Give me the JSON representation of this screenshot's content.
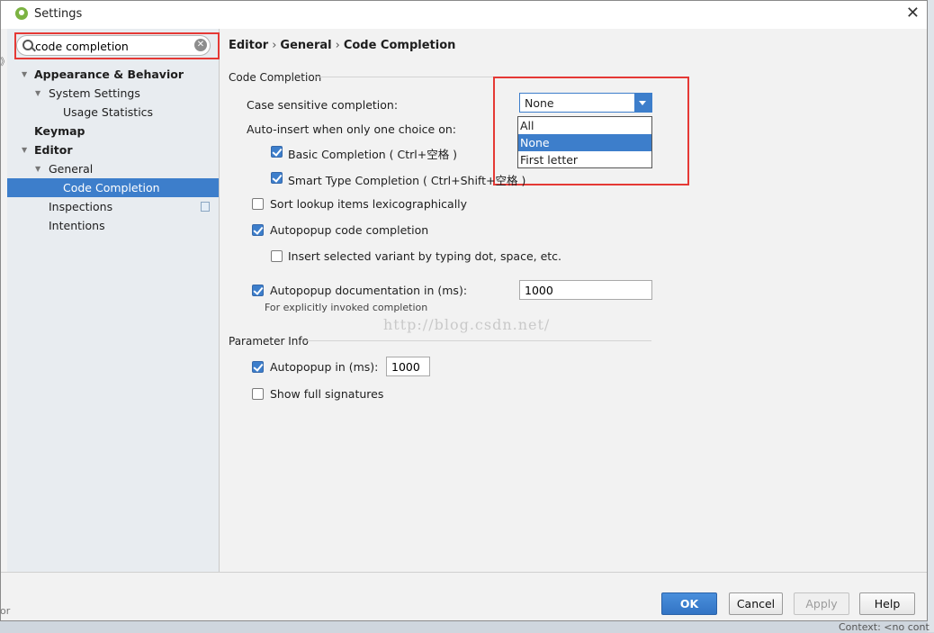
{
  "window": {
    "title": "Settings",
    "close_glyph": "✕"
  },
  "search": {
    "value": "code completion",
    "clear_glyph": "✕"
  },
  "tree": [
    {
      "label": "Appearance & Behavior"
    },
    {
      "label": "System Settings"
    },
    {
      "label": "Usage Statistics"
    },
    {
      "label": "Keymap"
    },
    {
      "label": "Editor"
    },
    {
      "label": "General"
    },
    {
      "label": "Code Completion"
    },
    {
      "label": "Inspections"
    },
    {
      "label": "Intentions"
    }
  ],
  "tree_arrow": "▼",
  "breadcrumb": {
    "part1": "Editor",
    "part2": "General",
    "part3": "Code Completion",
    "sep": "›"
  },
  "code_completion": {
    "section_title": "Code Completion",
    "case_sensitive_label": "Case sensitive completion:",
    "case_sensitive_value": "None",
    "dropdown_options": [
      "All",
      "None",
      "First letter"
    ],
    "dropdown_selected": "None",
    "auto_insert_label": "Auto-insert when only one choice on:",
    "basic_completion": {
      "label": "Basic Completion ( Ctrl+空格 )",
      "checked": true
    },
    "smart_type_completion": {
      "label": "Smart Type Completion ( Ctrl+Shift+空格 )",
      "checked": true
    },
    "sort_lexicographically": {
      "label": "Sort lookup items lexicographically",
      "checked": false
    },
    "autopopup_code_completion": {
      "label": "Autopopup code completion",
      "checked": true
    },
    "insert_selected_variant": {
      "label": "Insert selected variant by typing dot, space, etc.",
      "checked": false
    },
    "autopopup_documentation": {
      "label": "Autopopup documentation in (ms):",
      "checked": true,
      "value": "1000"
    },
    "explicit_note": "For explicitly invoked completion"
  },
  "parameter_info": {
    "section_title": "Parameter Info",
    "autopopup": {
      "label": "Autopopup in (ms):",
      "checked": true,
      "value": "1000"
    },
    "show_full_signatures": {
      "label": "Show full signatures",
      "checked": false
    }
  },
  "watermark": "http://blog.csdn.net/",
  "buttons": {
    "ok": "OK",
    "cancel": "Cancel",
    "apply": "Apply",
    "help": "Help"
  },
  "background": {
    "status_text": "Context: <no cont",
    "edge_glyph": "》",
    "edge_glyph2": "or"
  },
  "colors": {
    "selection": "#3d7ecb",
    "highlight_box": "#e53935"
  }
}
